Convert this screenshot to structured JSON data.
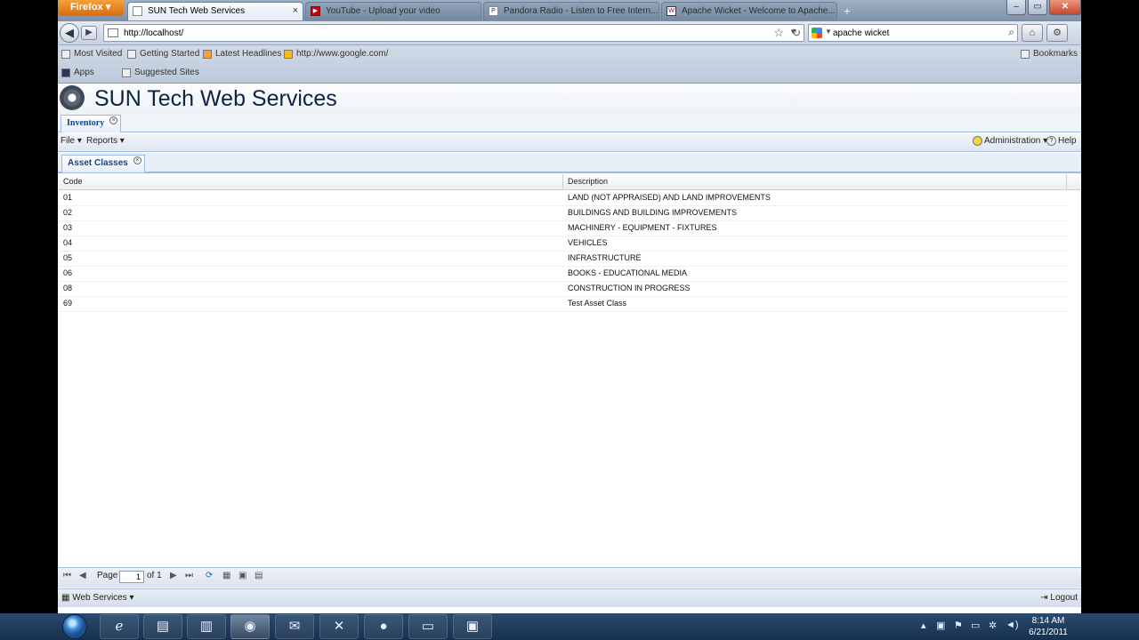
{
  "browser": {
    "app_button": "Firefox",
    "tabs": [
      {
        "label": "SUN Tech Web Services",
        "active": true
      },
      {
        "label": "YouTube - Upload your video",
        "active": false
      },
      {
        "label": "Pandora Radio - Listen to Free Intern...",
        "active": false
      },
      {
        "label": "Apache Wicket - Welcome to Apache...",
        "active": false
      }
    ],
    "new_tab": "+",
    "url": "http://localhost/",
    "search_value": "apache wicket",
    "bookmarks": [
      "Most Visited",
      "Getting Started",
      "Latest Headlines",
      "http://www.google.com/",
      "Apps",
      "Suggested Sites"
    ],
    "bookmarks_right": "Bookmarks"
  },
  "app": {
    "title": "SUN Tech Web Services",
    "module_tab": "Inventory",
    "menu_left": [
      "File",
      "Reports"
    ],
    "menu_right": [
      "Administration",
      "Help"
    ],
    "sub_tab": "Asset Classes"
  },
  "grid": {
    "columns": [
      "Code",
      "Description"
    ],
    "rows": [
      {
        "code": "01",
        "description": "LAND (NOT APPRAISED) AND LAND IMPROVEMENTS"
      },
      {
        "code": "02",
        "description": "BUILDINGS AND BUILDING IMPROVEMENTS"
      },
      {
        "code": "03",
        "description": "MACHINERY - EQUIPMENT - FIXTURES"
      },
      {
        "code": "04",
        "description": "VEHICLES"
      },
      {
        "code": "05",
        "description": "INFRASTRUCTURE"
      },
      {
        "code": "06",
        "description": "BOOKS - EDUCATIONAL MEDIA"
      },
      {
        "code": "08",
        "description": "CONSTRUCTION IN PROGRESS"
      },
      {
        "code": "69",
        "description": "Test Asset Class"
      }
    ]
  },
  "pager": {
    "page_label": "Page",
    "page_value": "1",
    "of_label": "of 1"
  },
  "statusbar": {
    "left": "Web Services",
    "right": "Logout"
  },
  "taskbar": {
    "time": "8:14 AM",
    "date": "6/21/2011"
  }
}
